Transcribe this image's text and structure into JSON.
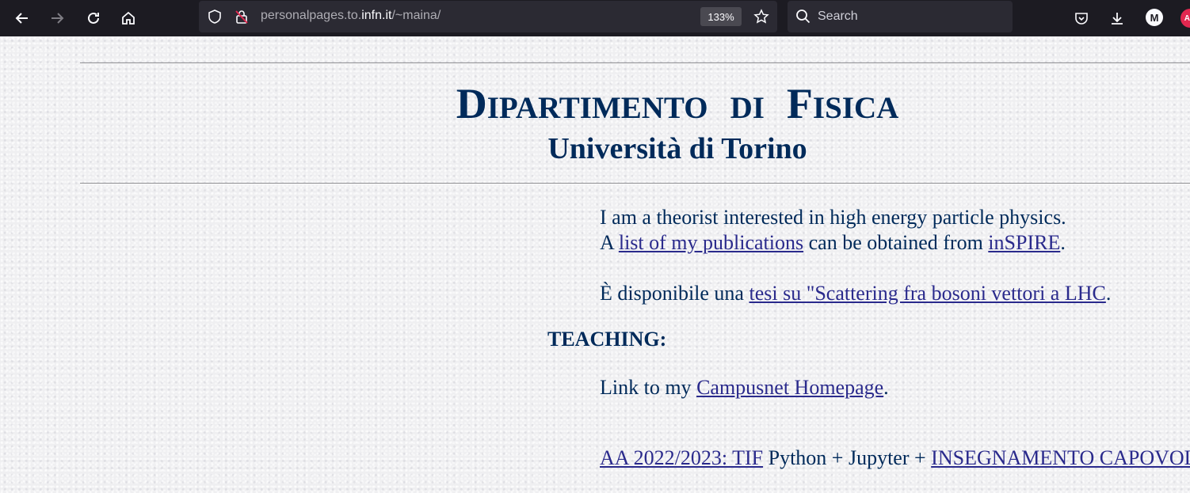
{
  "browser": {
    "url_prefix": "personalpages.to.",
    "url_host": "infn.it",
    "url_path": "/~maina/",
    "zoom": "133%",
    "search_placeholder": "Search",
    "profile_initial": "M",
    "extension_badge": "AB"
  },
  "header": {
    "dept_initial_1": "D",
    "dept_rest_1": "IPARTIMENTO",
    "dept_word_2": "DI",
    "dept_initial_3": "F",
    "dept_rest_3": "ISICA",
    "university": "Università di Torino"
  },
  "intro": {
    "line1": "I am a theorist interested in high energy particle physics.",
    "line2_prefix": "A ",
    "publications_link": "list of my publications",
    "line2_middle": " can be obtained from ",
    "inspire_link": "inSPIRE",
    "line2_suffix": ".",
    "thesis_prefix": "È disponibile una ",
    "thesis_link": "tesi su \"Scattering fra bosoni vettori a LHC",
    "thesis_suffix": "."
  },
  "teaching": {
    "heading": "TEACHING:",
    "campusnet_prefix": "Link to my ",
    "campusnet_link": "Campusnet Homepage",
    "campusnet_suffix": ".",
    "course_link": "AA 2022/2023: TIF",
    "course_middle": " Python + Jupyter + ",
    "course_link_2": "INSEGNAMENTO CAPOVOLTO"
  }
}
